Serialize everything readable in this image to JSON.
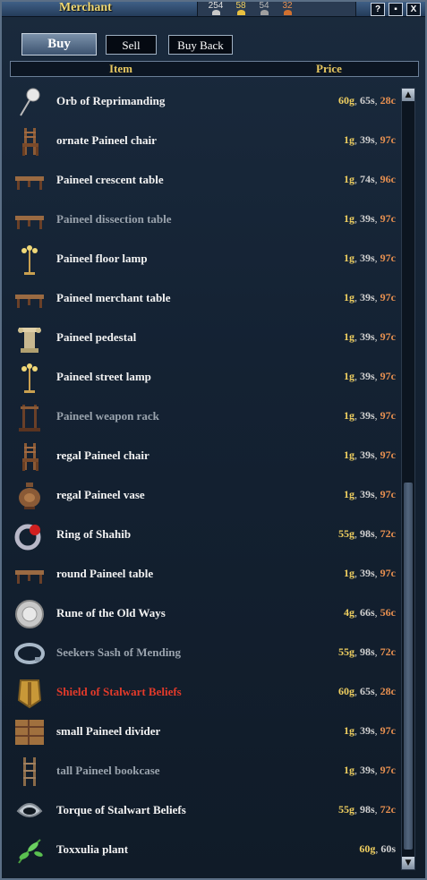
{
  "window": {
    "title": "Merchant"
  },
  "coins": [
    {
      "value": "254",
      "color": "#e0e0e0",
      "dot": "#c8c8c8"
    },
    {
      "value": "58",
      "color": "#f0d060",
      "dot": "#e8c040"
    },
    {
      "value": "54",
      "color": "#b8b8b8",
      "dot": "#a0a0a0"
    },
    {
      "value": "32",
      "color": "#e89050",
      "dot": "#d07030"
    }
  ],
  "title_buttons": {
    "help": "?",
    "minimize": "▪",
    "close": "X"
  },
  "tabs": {
    "buy": "Buy",
    "sell": "Sell",
    "buyback": "Buy Back"
  },
  "columns": {
    "item": "Item",
    "price": "Price"
  },
  "items": [
    {
      "name": "Orb of Reprimanding",
      "g": "60g",
      "s": "65s",
      "c": "28c",
      "icon": "orb-icon",
      "style": "normal"
    },
    {
      "name": "ornate Paineel chair",
      "g": "1g",
      "s": "39s",
      "c": "97c",
      "icon": "chair-icon",
      "style": "normal"
    },
    {
      "name": "Paineel crescent table",
      "g": "1g",
      "s": "74s",
      "c": "96c",
      "icon": "table-icon",
      "style": "normal"
    },
    {
      "name": "Paineel dissection table",
      "g": "1g",
      "s": "39s",
      "c": "97c",
      "icon": "table-icon",
      "style": "gray"
    },
    {
      "name": "Paineel floor lamp",
      "g": "1g",
      "s": "39s",
      "c": "97c",
      "icon": "lamp-icon",
      "style": "normal"
    },
    {
      "name": "Paineel merchant table",
      "g": "1g",
      "s": "39s",
      "c": "97c",
      "icon": "table-icon",
      "style": "normal"
    },
    {
      "name": "Paineel pedestal",
      "g": "1g",
      "s": "39s",
      "c": "97c",
      "icon": "pedestal-icon",
      "style": "normal"
    },
    {
      "name": "Paineel street lamp",
      "g": "1g",
      "s": "39s",
      "c": "97c",
      "icon": "lamp-icon",
      "style": "normal"
    },
    {
      "name": "Paineel weapon rack",
      "g": "1g",
      "s": "39s",
      "c": "97c",
      "icon": "rack-icon",
      "style": "gray"
    },
    {
      "name": "regal Paineel chair",
      "g": "1g",
      "s": "39s",
      "c": "97c",
      "icon": "chair-icon",
      "style": "normal"
    },
    {
      "name": "regal Paineel vase",
      "g": "1g",
      "s": "39s",
      "c": "97c",
      "icon": "vase-icon",
      "style": "normal"
    },
    {
      "name": "Ring of Shahib",
      "g": "55g",
      "s": "98s",
      "c": "72c",
      "icon": "ring-icon",
      "style": "normal"
    },
    {
      "name": "round Paineel table",
      "g": "1g",
      "s": "39s",
      "c": "97c",
      "icon": "table-icon",
      "style": "normal"
    },
    {
      "name": "Rune of the Old Ways",
      "g": "4g",
      "s": "66s",
      "c": "56c",
      "icon": "rune-icon",
      "style": "normal"
    },
    {
      "name": "Seekers Sash of Mending",
      "g": "55g",
      "s": "98s",
      "c": "72c",
      "icon": "sash-icon",
      "style": "gray"
    },
    {
      "name": "Shield of Stalwart Beliefs",
      "g": "60g",
      "s": "65s",
      "c": "28c",
      "icon": "shield-icon",
      "style": "red"
    },
    {
      "name": "small Paineel divider",
      "g": "1g",
      "s": "39s",
      "c": "97c",
      "icon": "divider-icon",
      "style": "normal"
    },
    {
      "name": "tall Paineel bookcase",
      "g": "1g",
      "s": "39s",
      "c": "97c",
      "icon": "bookcase-icon",
      "style": "gray"
    },
    {
      "name": "Torque of Stalwart Beliefs",
      "g": "55g",
      "s": "98s",
      "c": "72c",
      "icon": "torque-icon",
      "style": "normal"
    },
    {
      "name": "Toxxulia plant",
      "g": "60g",
      "s": "60s",
      "c": "",
      "icon": "plant-icon",
      "style": "normal"
    }
  ],
  "scrollbar": {
    "up": "▲",
    "down": "▼"
  }
}
